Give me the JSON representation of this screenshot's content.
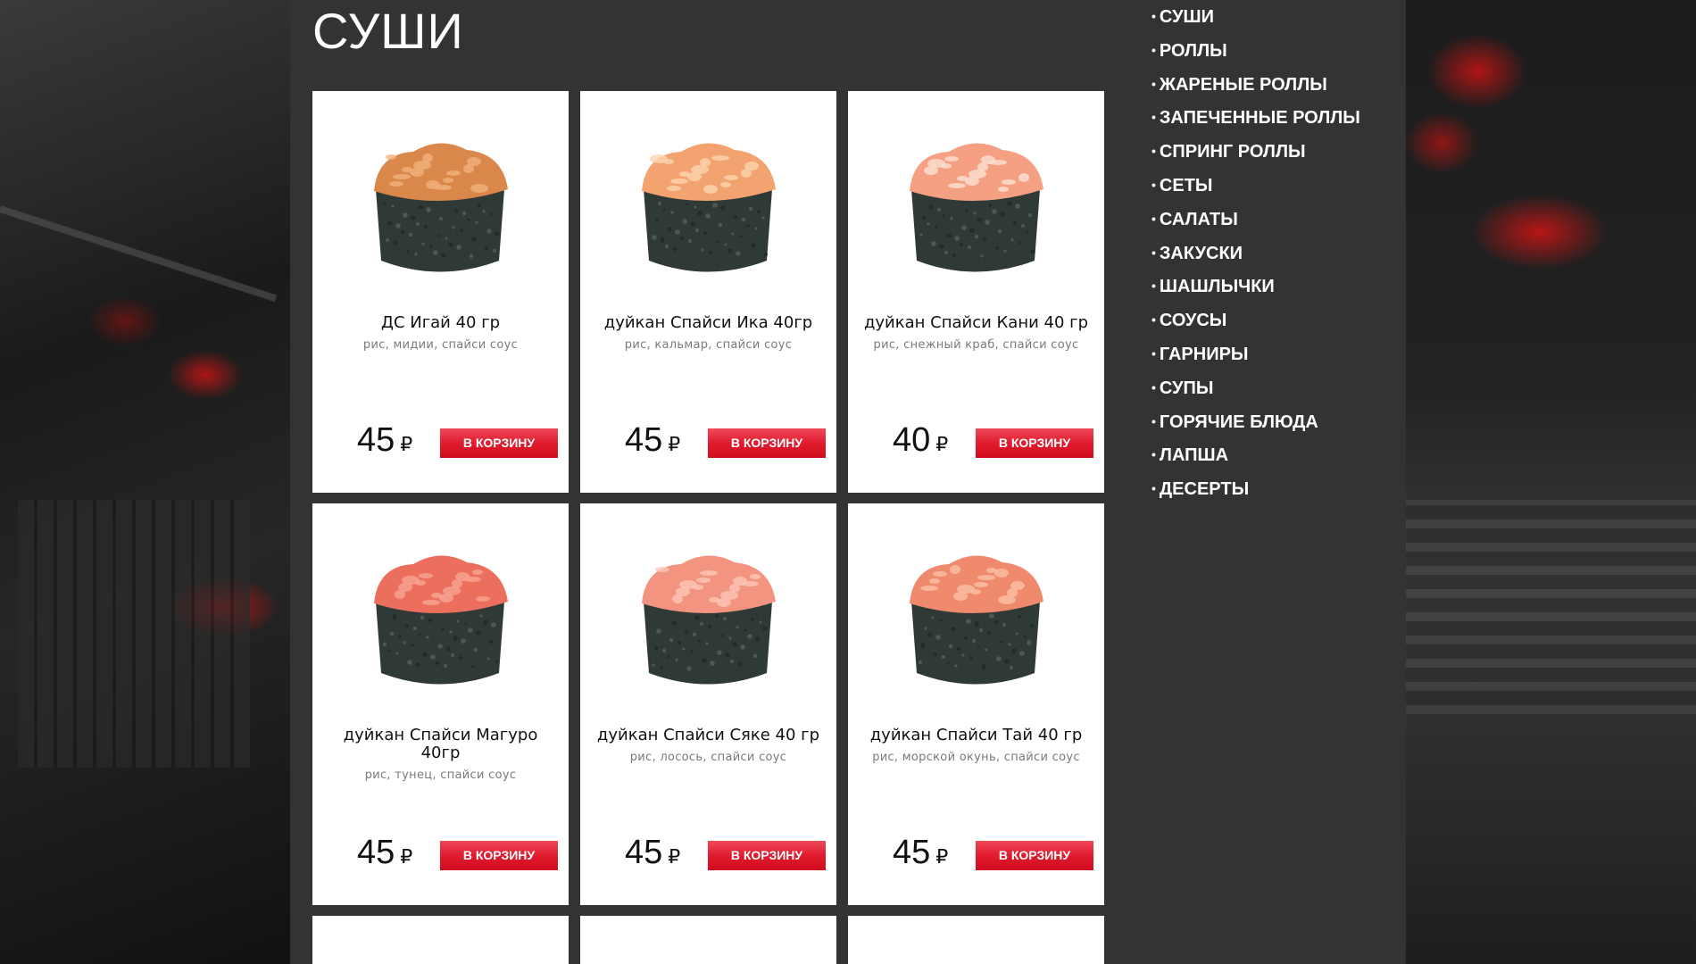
{
  "page": {
    "title": "СУШИ"
  },
  "products": [
    {
      "name": "ДС Игай 40 гр",
      "description": "рис, мидии, спайси соус",
      "price": "45",
      "currency": "₽",
      "button": "В КОРЗИНУ",
      "topping": "#d9874a",
      "topping_hi": "#f0b27a"
    },
    {
      "name": "дуйкан Спайси Ика 40гр",
      "description": "рис, кальмар, спайси соус",
      "price": "45",
      "currency": "₽",
      "button": "В КОРЗИНУ",
      "topping": "#f2a36f",
      "topping_hi": "#fbd3ae"
    },
    {
      "name": "дуйкан Спайси Кани 40 гр",
      "description": "рис, снежный краб, спайси соус",
      "price": "40",
      "currency": "₽",
      "button": "В КОРЗИНУ",
      "topping": "#f5a082",
      "topping_hi": "#fde0d2"
    },
    {
      "name": "дуйкан Спайси Магуро 40гр",
      "description": "рис, тунец, спайси соус",
      "price": "45",
      "currency": "₽",
      "button": "В КОРЗИНУ",
      "topping": "#ec6f5e",
      "topping_hi": "#f7a592"
    },
    {
      "name": "дуйкан Спайси Сяке 40 гр",
      "description": "рис, лосось, спайси соус",
      "price": "45",
      "currency": "₽",
      "button": "В КОРЗИНУ",
      "topping": "#f29480",
      "topping_hi": "#fcc5b6"
    },
    {
      "name": "дуйкан Спайси Тай 40 гр",
      "description": "рис, морской окунь, спайси соус",
      "price": "45",
      "currency": "₽",
      "button": "В КОРЗИНУ",
      "topping": "#f08a6c",
      "topping_hi": "#fbbfa5"
    }
  ],
  "menu": [
    "СУШИ",
    "РОЛЛЫ",
    "ЖАРЕНЫЕ РОЛЛЫ",
    "ЗАПЕЧЕННЫЕ РОЛЛЫ",
    "СПРИНГ РОЛЛЫ",
    "СЕТЫ",
    "САЛАТЫ",
    "ЗАКУСКИ",
    "ШАШЛЫЧКИ",
    "СОУСЫ",
    "ГАРНИРЫ",
    "СУПЫ",
    "ГОРЯЧИЕ БЛЮДА",
    "ЛАПША",
    "ДЕСЕРТЫ"
  ],
  "colors": {
    "panel": "#333333",
    "button": "#e01b2e",
    "nori": "#2f3a36"
  },
  "icons": {
    "bullet": "•"
  }
}
